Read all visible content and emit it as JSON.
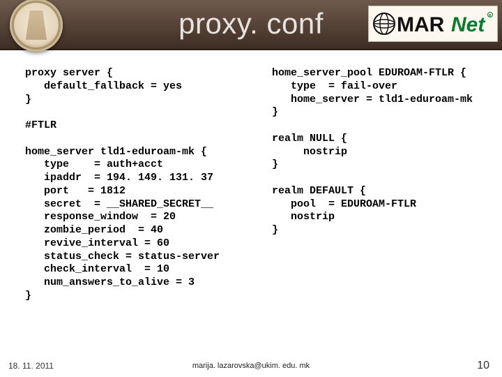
{
  "header": {
    "title": "proxy. conf",
    "logo_text_left": "MAR",
    "logo_text_right": "Net",
    "seal_name": "university-seal"
  },
  "code": {
    "left": "proxy server {\n   default_fallback = yes\n}\n\n#FTLR\n\nhome_server tld1-eduroam-mk {\n   type    = auth+acct\n   ipaddr  = 194. 149. 131. 37\n   port   = 1812\n   secret  = __SHARED_SECRET__\n   response_window  = 20\n   zombie_period  = 40\n   revive_interval = 60\n   status_check = status-server\n   check_interval  = 10\n   num_answers_to_alive = 3\n}",
    "right": "home_server_pool EDUROAM-FTLR {\n   type  = fail-over\n   home_server = tld1-eduroam-mk\n}\n\nrealm NULL {\n     nostrip\n}\n\nrealm DEFAULT {\n   pool  = EDUROAM-FTLR\n   nostrip\n}"
  },
  "footer": {
    "date": "18. 11. 2011",
    "email": "marija. lazarovska@ukim. edu. mk",
    "page": "10"
  }
}
